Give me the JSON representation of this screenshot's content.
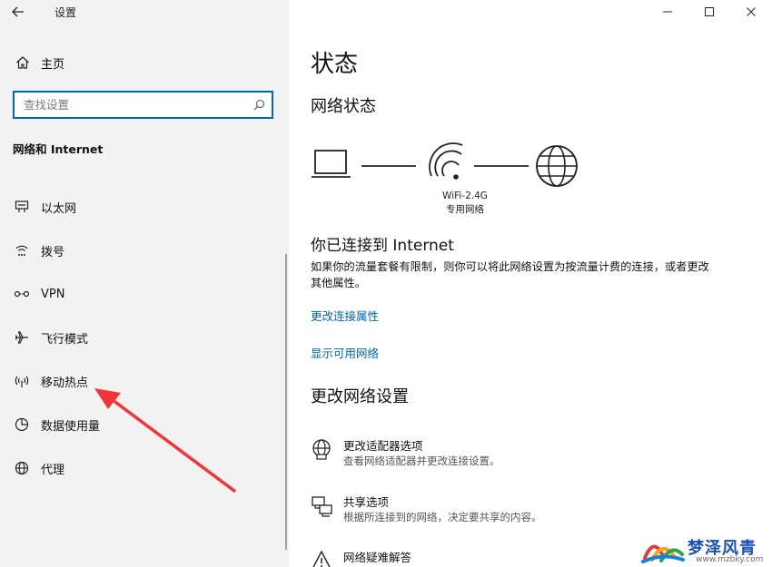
{
  "window": {
    "title": "设置",
    "controls": [
      "minimize-icon",
      "maximize-icon",
      "close-icon"
    ]
  },
  "sidebar": {
    "home_label": "主页",
    "search_placeholder": "查找设置",
    "section_title": "网络和 Internet",
    "items": [
      {
        "label": "以太网",
        "icon": "ethernet-icon"
      },
      {
        "label": "拨号",
        "icon": "dialup-icon"
      },
      {
        "label": "VPN",
        "icon": "vpn-icon"
      },
      {
        "label": "飞行模式",
        "icon": "airplane-icon"
      },
      {
        "label": "移动热点",
        "icon": "hotspot-icon"
      },
      {
        "label": "数据使用量",
        "icon": "data-usage-icon"
      },
      {
        "label": "代理",
        "icon": "globe-icon"
      }
    ]
  },
  "main": {
    "page_title": "状态",
    "network_status_title": "网络状态",
    "network_name": "WiFi-2.4G",
    "network_type": "专用网络",
    "connected_title": "你已连接到 Internet",
    "connected_desc": "如果你的流量套餐有限制，则你可以将此网络设置为按流量计费的连接，或者更改其他属性。",
    "links": [
      "更改连接属性",
      "显示可用网络"
    ],
    "change_section_title": "更改网络设置",
    "options": [
      {
        "title": "更改适配器选项",
        "desc": "查看网络适配器并更改连接设置。",
        "icon": "adapter-globe-icon"
      },
      {
        "title": "共享选项",
        "desc": "根据所连接到的网络，决定要共享的内容。",
        "icon": "sharing-icon"
      },
      {
        "title": "网络疑难解答",
        "desc": "",
        "icon": "warning-icon"
      }
    ]
  },
  "watermark": {
    "text": "梦泽风青",
    "url": "www.mzbky.com"
  },
  "colors": {
    "accent": "#0067c0",
    "link": "#0063b1",
    "sidebar_bg": "#f2f2f2",
    "arrow": "#f0353a"
  }
}
